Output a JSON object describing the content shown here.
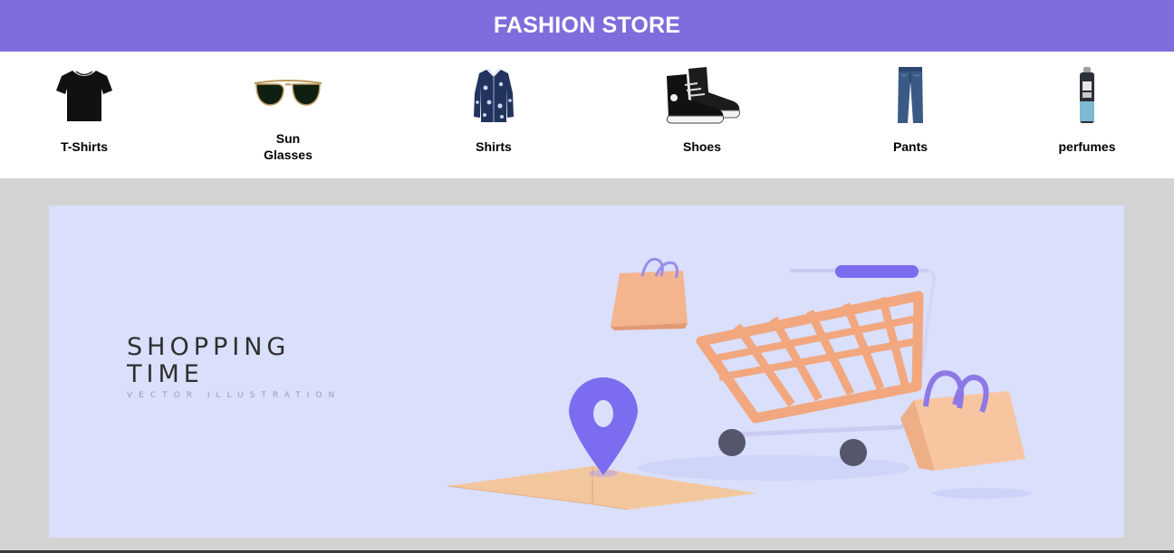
{
  "header": {
    "title": "FASHION STORE"
  },
  "categories": [
    {
      "label": "T-Shirts",
      "icon": "tshirt-icon"
    },
    {
      "label_line1": "Sun",
      "label_line2": "Glasses",
      "icon": "sunglasses-icon"
    },
    {
      "label": "Shirts",
      "icon": "shirt-icon"
    },
    {
      "label": "Shoes",
      "icon": "shoes-icon"
    },
    {
      "label": "Pants",
      "icon": "pants-icon"
    },
    {
      "label": "perfumes",
      "icon": "perfume-icon"
    }
  ],
  "banner": {
    "title_line1": "SHOPPING",
    "title_line2": "TIME",
    "subtitle": "VECTOR ILLUSTRATION",
    "illustration": "shopping-cart-illustration"
  },
  "colors": {
    "header_bg": "#7e6ddc",
    "page_bg": "#d3d3d3",
    "banner_bg": "#dadffc",
    "accent_purple": "#7c6cf0",
    "accent_peach": "#f4b48e"
  }
}
